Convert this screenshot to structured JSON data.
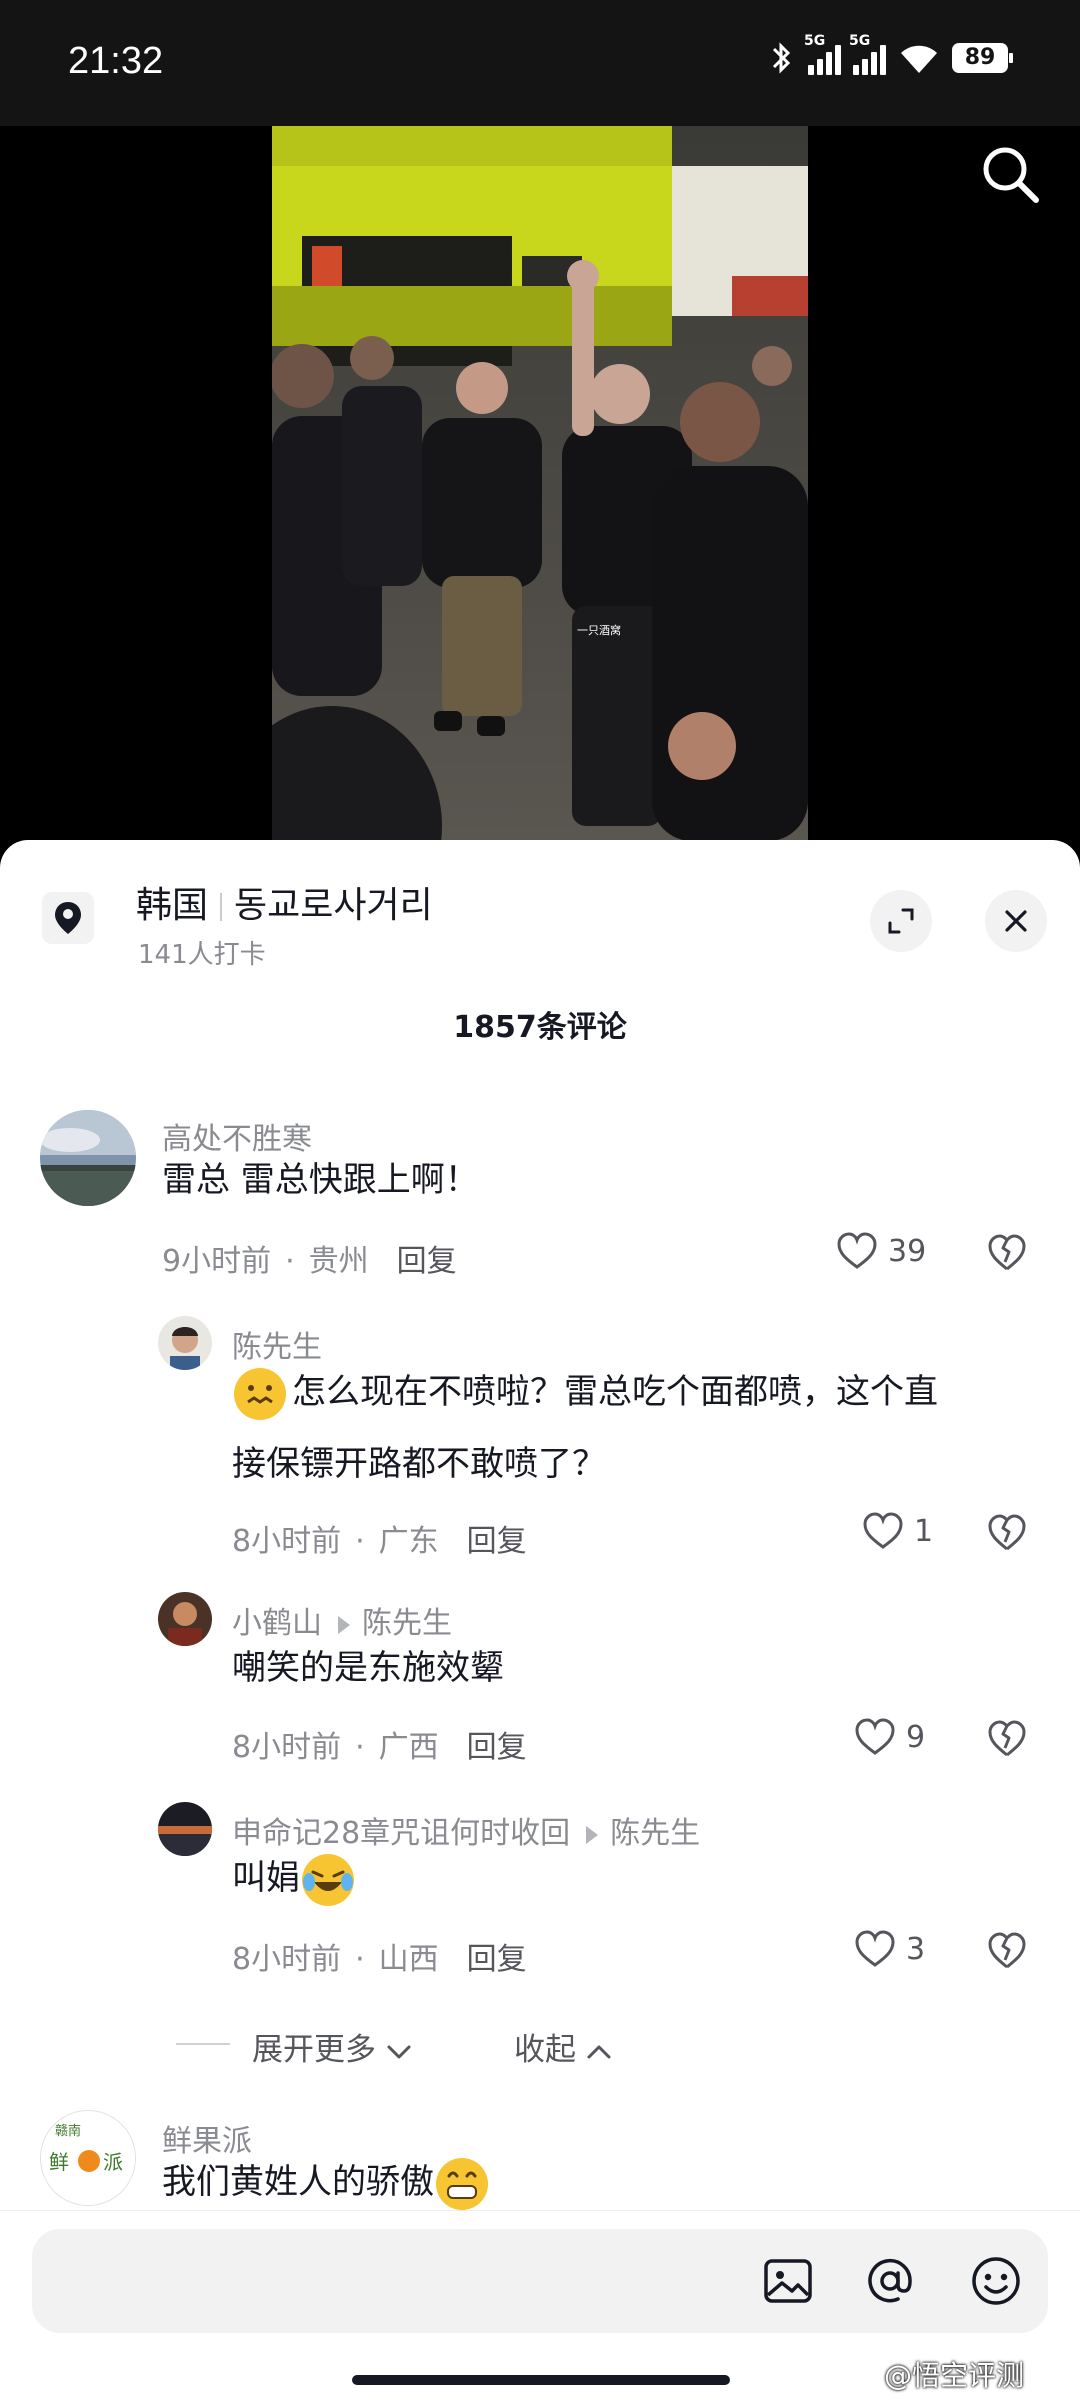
{
  "status_bar": {
    "time": "21:32",
    "net1": "5G",
    "net2": "5G",
    "battery": "89",
    "icons": [
      "bluetooth-icon",
      "signal-icon",
      "signal-icon",
      "wifi-icon",
      "battery-icon"
    ]
  },
  "video": {
    "overlay_text": "一只酒窝"
  },
  "location": {
    "country": "韩国",
    "place": "동교로사거리",
    "checkins": "141人打卡"
  },
  "comments_header": "1857条评论",
  "comments": [
    {
      "user": "高处不胜寒",
      "text": "雷总 雷总快跟上啊！",
      "time": "9小时前",
      "region": "贵州",
      "reply": "回复",
      "likes": "39"
    }
  ],
  "replies": [
    {
      "user": "陈先生",
      "text_line1": "怎么现在不喷啦？雷总吃个面都喷，这个直",
      "text_line2": "接保镖开路都不敢喷了？",
      "time": "8小时前",
      "region": "广东",
      "reply": "回复",
      "likes": "1"
    },
    {
      "user": "小鹤山",
      "reply_to": "陈先生",
      "text": "嘲笑的是东施效颦",
      "time": "8小时前",
      "region": "广西",
      "reply": "回复",
      "likes": "9"
    },
    {
      "user": "申命记28章咒诅何时收回",
      "reply_to": "陈先生",
      "text": "叫娟",
      "time": "8小时前",
      "region": "山西",
      "reply": "回复",
      "likes": "3"
    }
  ],
  "expand_more": "展开更多",
  "collapse": "收起",
  "next_comment": {
    "user": "鲜果派",
    "text": "我们黄姓人的骄傲",
    "avatar_text": "赣南 鲜果派"
  },
  "input": {
    "placeholder": "",
    "icons": [
      "image-icon",
      "at-icon",
      "emoji-icon"
    ]
  },
  "watermark": "@悟空评测",
  "colors": {
    "like_gray": "#55565c",
    "meta_gray": "#8a8b91",
    "panel_bg": "#ffffff"
  }
}
